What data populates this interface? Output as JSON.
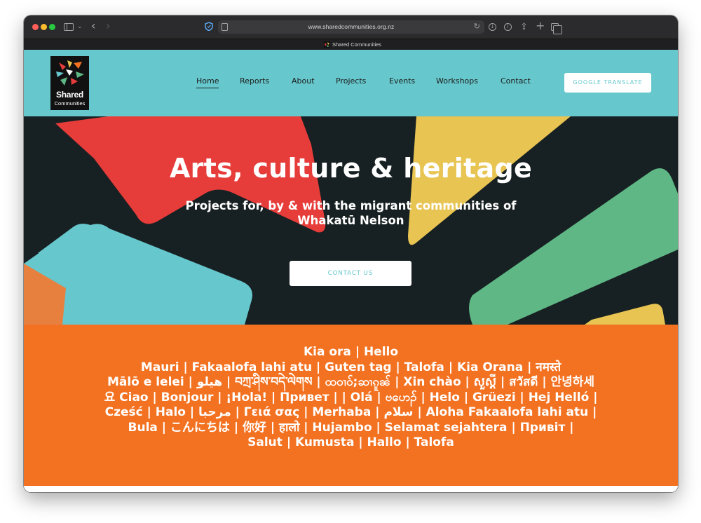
{
  "browser": {
    "url": "www.sharedcommunities.org.nz",
    "tab_title": "Shared Communities"
  },
  "logo": {
    "line1": "Shared",
    "line2": "Communities"
  },
  "nav": {
    "items": [
      {
        "label": "Home",
        "active": true
      },
      {
        "label": "Reports",
        "active": false
      },
      {
        "label": "About",
        "active": false
      },
      {
        "label": "Projects",
        "active": false
      },
      {
        "label": "Events",
        "active": false
      },
      {
        "label": "Workshops",
        "active": false
      },
      {
        "label": "Contact",
        "active": false
      }
    ],
    "translate_button": "GOOGLE TRANSLATE"
  },
  "hero": {
    "title": "Arts, culture & heritage",
    "subtitle": "Projects for, by & with the migrant communities of Whakatū Nelson",
    "button": "CONTACT US"
  },
  "greetings": {
    "lines": [
      "Kia ora | Hello",
      "Mauri | Fakaalofa lahi atu | Guten tag | Talofa | Kia Orana | नमस्ते",
      "Mālō e lelei | هیلو | བཀྲ་ཤིས་བདེ་ལེགས | ထ၀ၢဝ်;ဆၢၵူၼ် | Xin chào | សួស្តី | สวัสดี | 안녕하세",
      "요 Ciao | Bonjour | ¡Hola! | Привет | | Olá | ဗဟေၣ် | Helo | Grüezi | Hej Helló |",
      "Cześć | Halo | مرحبا | Γειά σας | Merhaba | سلام | Aloha Fakaalofa lahi atu |",
      "Bula | こんにちは | 你好 | हालो | Hujambo | Selamat sejahtera | Привіт |",
      "Salut | Kumusta | Hallo | Talofa"
    ]
  },
  "colors": {
    "header_teal": "#66c7cc",
    "hero_dark": "#172022",
    "orange": "#f37221",
    "red": "#e63c3a",
    "yellow": "#e8c452",
    "green": "#5fb785"
  }
}
